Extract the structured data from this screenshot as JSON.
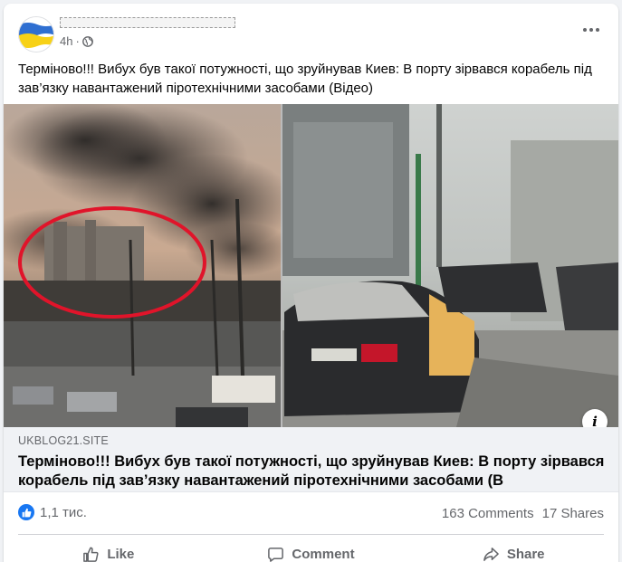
{
  "post": {
    "author_redacted": true,
    "time": "4h",
    "separator": "·",
    "text": "Терміново!!! Вибух був такої потужності, що зруйнував Киев: В порту зірвався корабель під зав’язку навантажений піротехнічними засобами (Відео)"
  },
  "link": {
    "domain": "UKBLOG21.SITE",
    "title": "Терміново!!! Вибух був такої потужності, що зруйнував Киев: В порту зірвався корабель під зав’язку навантажений піротехнічними засобами (В"
  },
  "stats": {
    "reactions_count": "1,1 тис.",
    "comments": "163 Comments",
    "shares": "17 Shares"
  },
  "actions": {
    "like": "Like",
    "comment": "Comment",
    "share": "Share"
  },
  "icons": {
    "avatar": "ukraine-flag-avatar",
    "privacy": "globe-icon",
    "menu": "more-options-icon",
    "info": "info-icon",
    "reaction": "like-reaction-icon"
  },
  "colors": {
    "flag_blue": "#2f6fd1",
    "flag_yellow": "#f7d117",
    "like_blue": "#1877f2",
    "circle_annotation": "#e0142a"
  }
}
